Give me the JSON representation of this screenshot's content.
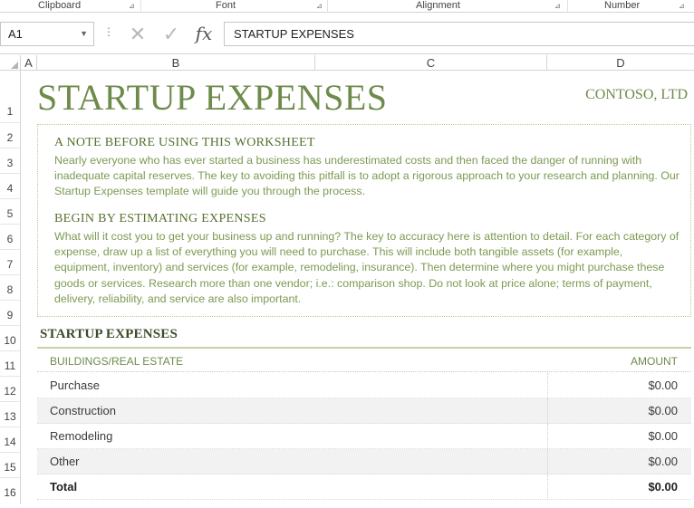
{
  "ribbon": {
    "groups": [
      "Clipboard",
      "Font",
      "Alignment",
      "Number"
    ]
  },
  "formula_bar": {
    "name_box": "A1",
    "cancel_icon": "✕",
    "enter_icon": "✓",
    "fx_label": "fx",
    "content": "STARTUP EXPENSES"
  },
  "columns": [
    "A",
    "B",
    "C",
    "D"
  ],
  "rows": [
    "1",
    "2",
    "3",
    "4",
    "5",
    "6",
    "7",
    "8",
    "9",
    "10",
    "11",
    "12",
    "13",
    "14",
    "15",
    "16"
  ],
  "sheet": {
    "title": "STARTUP EXPENSES",
    "company": "CONTOSO, LTD",
    "note": {
      "heading1": "A NOTE BEFORE USING THIS WORKSHEET",
      "para1": "Nearly everyone who has ever started a business has underestimated costs and then faced the danger of running with inadequate capital reserves. The key to avoiding this pitfall is to adopt a rigorous approach to your research and planning. Our Startup Expenses template will guide you through the process.",
      "heading2": "BEGIN BY ESTIMATING EXPENSES",
      "para2": "What will it cost you to get your business up and running?  The key to accuracy here is attention to detail. For each category of expense, draw up a list of everything you will need to purchase. This will include both tangible assets (for example, equipment, inventory) and services (for example, remodeling, insurance). Then determine where you might purchase these goods or services. Research more than one vendor; i.e.: comparison shop. Do not look at price alone; terms of payment, delivery, reliability, and service are also important."
    },
    "section_title": "STARTUP EXPENSES",
    "table": {
      "header_left": "BUILDINGS/REAL ESTATE",
      "header_right": "AMOUNT",
      "rows": [
        {
          "label": "Purchase",
          "amount": "$0.00"
        },
        {
          "label": "Construction",
          "amount": "$0.00"
        },
        {
          "label": "Remodeling",
          "amount": "$0.00"
        },
        {
          "label": "Other",
          "amount": "$0.00"
        }
      ],
      "total": {
        "label": "Total",
        "amount": "$0.00"
      }
    }
  },
  "colors": {
    "accent_green": "#6e8b4b",
    "text_green": "#7c9a52"
  }
}
